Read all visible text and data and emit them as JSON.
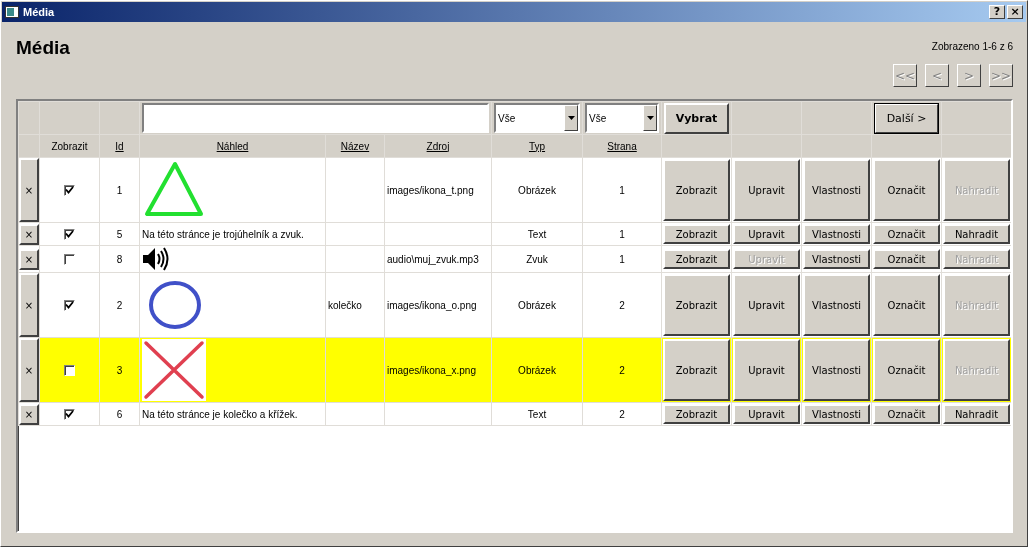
{
  "window": {
    "title": "Média",
    "help_button": "?",
    "close_button": "×"
  },
  "heading": "Média",
  "record_info": "Zobrazeno 1-6 z 6",
  "pager": [
    {
      "label": "<<",
      "disabled": true
    },
    {
      "label": "<",
      "disabled": true
    },
    {
      "label": ">",
      "disabled": true
    },
    {
      "label": ">>",
      "disabled": true
    }
  ],
  "filter": {
    "type_select": "Vše",
    "page_select": "Vše",
    "select_button": "Vybrat",
    "next_button": "Další >"
  },
  "columns": [
    "Zobrazit",
    "Id",
    "Náhled",
    "Název",
    "Zdroj",
    "Typ",
    "Strana"
  ],
  "rows": [
    {
      "delete": "×",
      "checked": true,
      "id": "1",
      "preview": {
        "kind": "triangle"
      },
      "source": "images/ikona_t.png",
      "type": "Obrázek",
      "page": "1",
      "selected": false,
      "tall": true,
      "buttons": [
        {
          "label": "Zobrazit",
          "disabled": false
        },
        {
          "label": "Upravit",
          "disabled": false
        },
        {
          "label": "Vlastnosti",
          "disabled": false
        },
        {
          "label": "Označit",
          "disabled": false
        },
        {
          "label": "Nahradit",
          "disabled": true
        }
      ]
    },
    {
      "delete": "×",
      "checked": true,
      "id": "5",
      "preview": {
        "kind": "text",
        "text": "Na této stránce je trojúhelník a zvuk."
      },
      "type": "Text",
      "page": "1",
      "selected": false,
      "tall": false,
      "buttons": [
        {
          "label": "Zobrazit",
          "disabled": false
        },
        {
          "label": "Upravit",
          "disabled": false
        },
        {
          "label": "Vlastnosti",
          "disabled": false
        },
        {
          "label": "Označit",
          "disabled": false
        },
        {
          "label": "Nahradit",
          "disabled": false
        }
      ]
    },
    {
      "delete": "×",
      "checked": false,
      "id": "8",
      "preview": {
        "kind": "sound"
      },
      "source": "audio\\muj_zvuk.mp3",
      "type": "Zvuk",
      "page": "1",
      "selected": false,
      "tall": false,
      "buttons": [
        {
          "label": "Zobrazit",
          "disabled": false
        },
        {
          "label": "Upravit",
          "disabled": true
        },
        {
          "label": "Vlastnosti",
          "disabled": false
        },
        {
          "label": "Označit",
          "disabled": false
        },
        {
          "label": "Nahradit",
          "disabled": true
        }
      ]
    },
    {
      "delete": "×",
      "checked": true,
      "id": "2",
      "preview": {
        "kind": "circle"
      },
      "name": "kolečko",
      "source": "images/ikona_o.png",
      "type": "Obrázek",
      "page": "2",
      "selected": false,
      "tall": true,
      "buttons": [
        {
          "label": "Zobrazit",
          "disabled": false
        },
        {
          "label": "Upravit",
          "disabled": false
        },
        {
          "label": "Vlastnosti",
          "disabled": false
        },
        {
          "label": "Označit",
          "disabled": false
        },
        {
          "label": "Nahradit",
          "disabled": true
        }
      ]
    },
    {
      "delete": "×",
      "checked": false,
      "id": "3",
      "preview": {
        "kind": "cross"
      },
      "source": "images/ikona_x.png",
      "type": "Obrázek",
      "page": "2",
      "selected": true,
      "tall": true,
      "buttons": [
        {
          "label": "Zobrazit",
          "disabled": false
        },
        {
          "label": "Upravit",
          "disabled": false
        },
        {
          "label": "Vlastnosti",
          "disabled": false
        },
        {
          "label": "Označit",
          "disabled": false
        },
        {
          "label": "Nahradit",
          "disabled": true
        }
      ]
    },
    {
      "delete": "×",
      "checked": true,
      "id": "6",
      "preview": {
        "kind": "text",
        "text": "Na této stránce je kolečko a křížek."
      },
      "type": "Text",
      "page": "2",
      "selected": false,
      "tall": false,
      "buttons": [
        {
          "label": "Zobrazit",
          "disabled": false
        },
        {
          "label": "Upravit",
          "disabled": false
        },
        {
          "label": "Vlastnosti",
          "disabled": false
        },
        {
          "label": "Označit",
          "disabled": false
        },
        {
          "label": "Nahradit",
          "disabled": false
        }
      ]
    }
  ]
}
